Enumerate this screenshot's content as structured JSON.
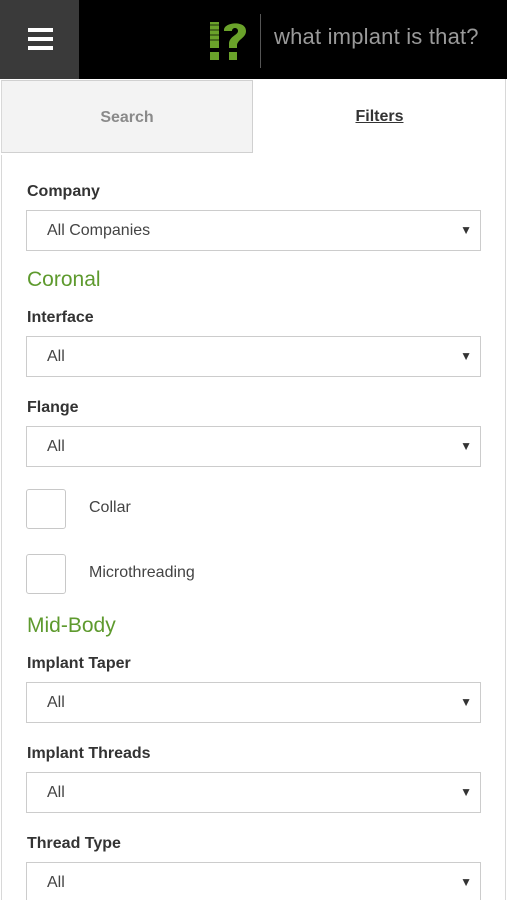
{
  "header": {
    "logo_mark": "!?",
    "logo_text": "what implant is that?"
  },
  "tabs": {
    "search_label": "Search",
    "filters_label": "Filters"
  },
  "filters": {
    "company": {
      "label": "Company",
      "value": "All Companies"
    },
    "coronal_heading": "Coronal",
    "interface": {
      "label": "Interface",
      "value": "All"
    },
    "flange": {
      "label": "Flange",
      "value": "All"
    },
    "collar": {
      "label": "Collar"
    },
    "microthreading": {
      "label": "Microthreading"
    },
    "midbody_heading": "Mid-Body",
    "implant_taper": {
      "label": "Implant Taper",
      "value": "All"
    },
    "implant_threads": {
      "label": "Implant Threads",
      "value": "All"
    },
    "thread_type": {
      "label": "Thread Type",
      "value": "All"
    }
  },
  "colors": {
    "accent_green": "#5e9a2e",
    "header_bg": "#000000",
    "menu_bg": "#3a3a3a"
  },
  "icons": {
    "menu": "hamburger-menu-icon",
    "dropdown": "caret-down-icon"
  }
}
